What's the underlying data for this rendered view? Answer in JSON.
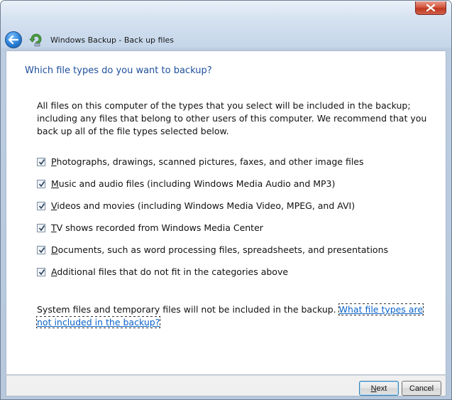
{
  "window": {
    "title": "Windows Backup - Back up files",
    "close_glyph": "close-icon",
    "back_glyph": "back-arrow-icon",
    "app_icon": "backup-icon"
  },
  "main": {
    "heading": "Which file types do you want to backup?",
    "intro": "All files on this computer of the types that you select will be included in the backup; including any files that belong to other users of this computer. We recommend that you back up all of the file types selected below.",
    "options": [
      {
        "mnemonic": "P",
        "rest": "hotographs, drawings, scanned pictures, faxes, and other image files",
        "checked": true
      },
      {
        "mnemonic": "M",
        "rest": "usic and audio files (including Windows Media Audio and MP3)",
        "checked": true
      },
      {
        "mnemonic": "V",
        "rest": "ideos and movies (including Windows Media Video, MPEG, and AVI)",
        "checked": true
      },
      {
        "mnemonic": "T",
        "rest": "V shows recorded from Windows Media Center",
        "checked": true
      },
      {
        "mnemonic": "D",
        "rest": "ocuments, such as word processing files, spreadsheets, and presentations",
        "checked": true
      },
      {
        "mnemonic": "A",
        "rest": "dditional files that do not fit in the categories above",
        "checked": true
      }
    ],
    "footer_text": "System files and temporary files will not be included in the backup. ",
    "footer_link": "What file types are not included in the backup?"
  },
  "buttons": {
    "next_mnemonic": "N",
    "next_rest": "ext",
    "cancel": "Cancel"
  },
  "colors": {
    "heading": "#1f4f9c",
    "link": "#0a63c9",
    "close": "#c0381f"
  }
}
